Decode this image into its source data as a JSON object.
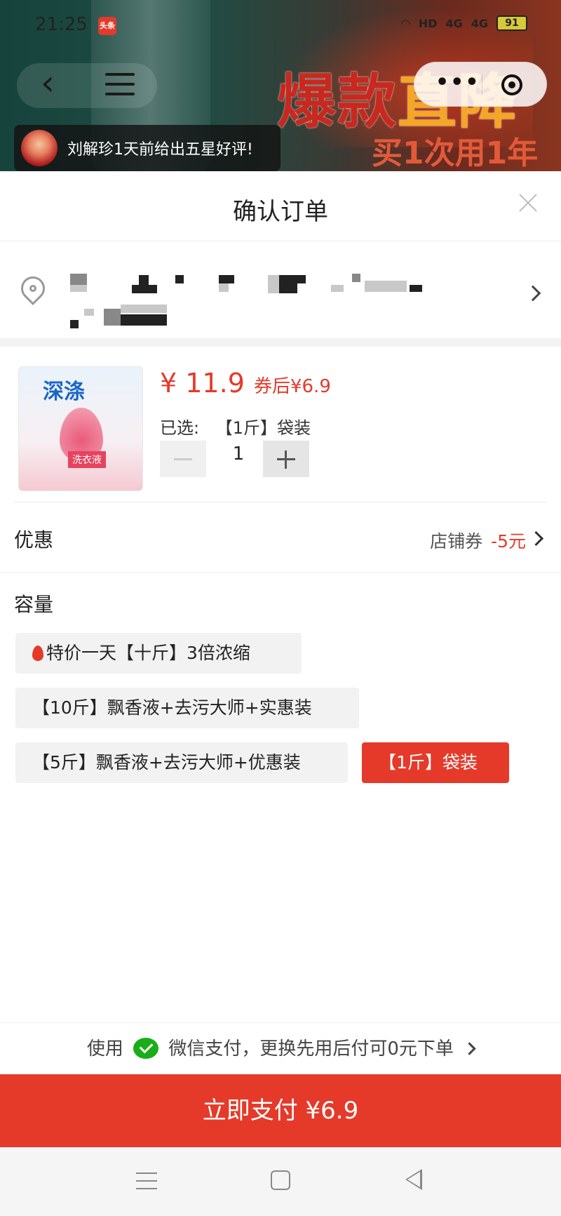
{
  "status_bar": {
    "time": "21:25",
    "app_badge": "头条",
    "network_a": "HD",
    "network_b": "4G",
    "network_c": "4G",
    "battery": "91"
  },
  "banner": {
    "promo_part1": "爆款",
    "promo_part2": "直降",
    "promo_sub": "买1次用1年"
  },
  "review_toast": {
    "text": "刘解珍1天前给出五星好评!"
  },
  "sheet": {
    "title": "确认订单"
  },
  "product": {
    "image_brand": "深涤",
    "image_tag": "洗衣液",
    "price": "¥ 11.9",
    "coupon_price": "券后¥6.9",
    "selected_label": "已选:",
    "selected_value": "【1斤】袋装",
    "quantity": "1"
  },
  "discount": {
    "label": "优惠",
    "coupon_name": "店铺券",
    "coupon_amount": "-5元"
  },
  "capacity": {
    "title": "容量",
    "options": [
      {
        "label": "特价一天【十斤】3倍浓缩",
        "selected": false,
        "hot": true
      },
      {
        "label": "【10斤】飘香液+去污大师+实惠装",
        "selected": false,
        "hot": false
      },
      {
        "label": "【5斤】飘香液+去污大师+优惠装",
        "selected": false,
        "hot": false
      },
      {
        "label": "【1斤】袋装",
        "selected": true,
        "hot": false
      }
    ]
  },
  "payment": {
    "note_prefix": "使用",
    "note_suffix": "微信支付，更换先用后付可0元下单",
    "button_label": "立即支付 ¥6.9"
  },
  "colors": {
    "accent": "#e53a2a",
    "wechat_green": "#1aad19"
  }
}
